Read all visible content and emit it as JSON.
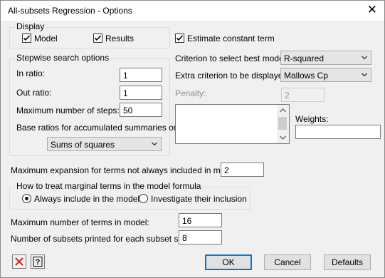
{
  "window": {
    "title": "All-subsets Regression - Options",
    "close_glyph": "✕"
  },
  "display": {
    "group_title": "Display",
    "model_label": "Model",
    "model_checked": true,
    "results_label": "Results",
    "results_checked": true
  },
  "estimate_constant": {
    "label": "Estimate constant term",
    "checked": true
  },
  "stepwise": {
    "group_title": "Stepwise search options",
    "in_ratio_label": "In ratio:",
    "in_ratio_value": "1",
    "out_ratio_label": "Out ratio:",
    "out_ratio_value": "1",
    "max_steps_label": "Maximum number of steps:",
    "max_steps_value": "50",
    "base_ratios_label": "Base ratios for accumulated summaries on:",
    "base_ratios_value": "Sums of squares"
  },
  "criterion": {
    "best_label": "Criterion to select best model:",
    "best_value": "R-squared",
    "extra_label": "Extra criterion to be displayed:",
    "extra_value": "Mallows Cp",
    "penalty_label": "Penalty:",
    "penalty_value": "2",
    "weights_label": "Weights:",
    "weights_value": ""
  },
  "max_expansion": {
    "label": "Maximum expansion for terms not always included in model:",
    "value": "2"
  },
  "marginal": {
    "group_title": "How to treat marginal terms in the model formula",
    "option_always": "Always include in the model",
    "option_investigate": "Investigate their inclusion",
    "selected": "always"
  },
  "max_terms": {
    "label": "Maximum number of terms in model:",
    "value": "16"
  },
  "subsets_printed": {
    "label": "Number of subsets printed for each subset size:",
    "value": "8"
  },
  "buttons": {
    "ok": "OK",
    "cancel": "Cancel",
    "defaults": "Defaults"
  },
  "icons": {
    "clear": "clear-icon",
    "help": "help-icon"
  },
  "colors": {
    "default_button_border": "#0078d7",
    "clear_icon": "#c42b1c",
    "dialog_bg": "#f0f0f0"
  }
}
